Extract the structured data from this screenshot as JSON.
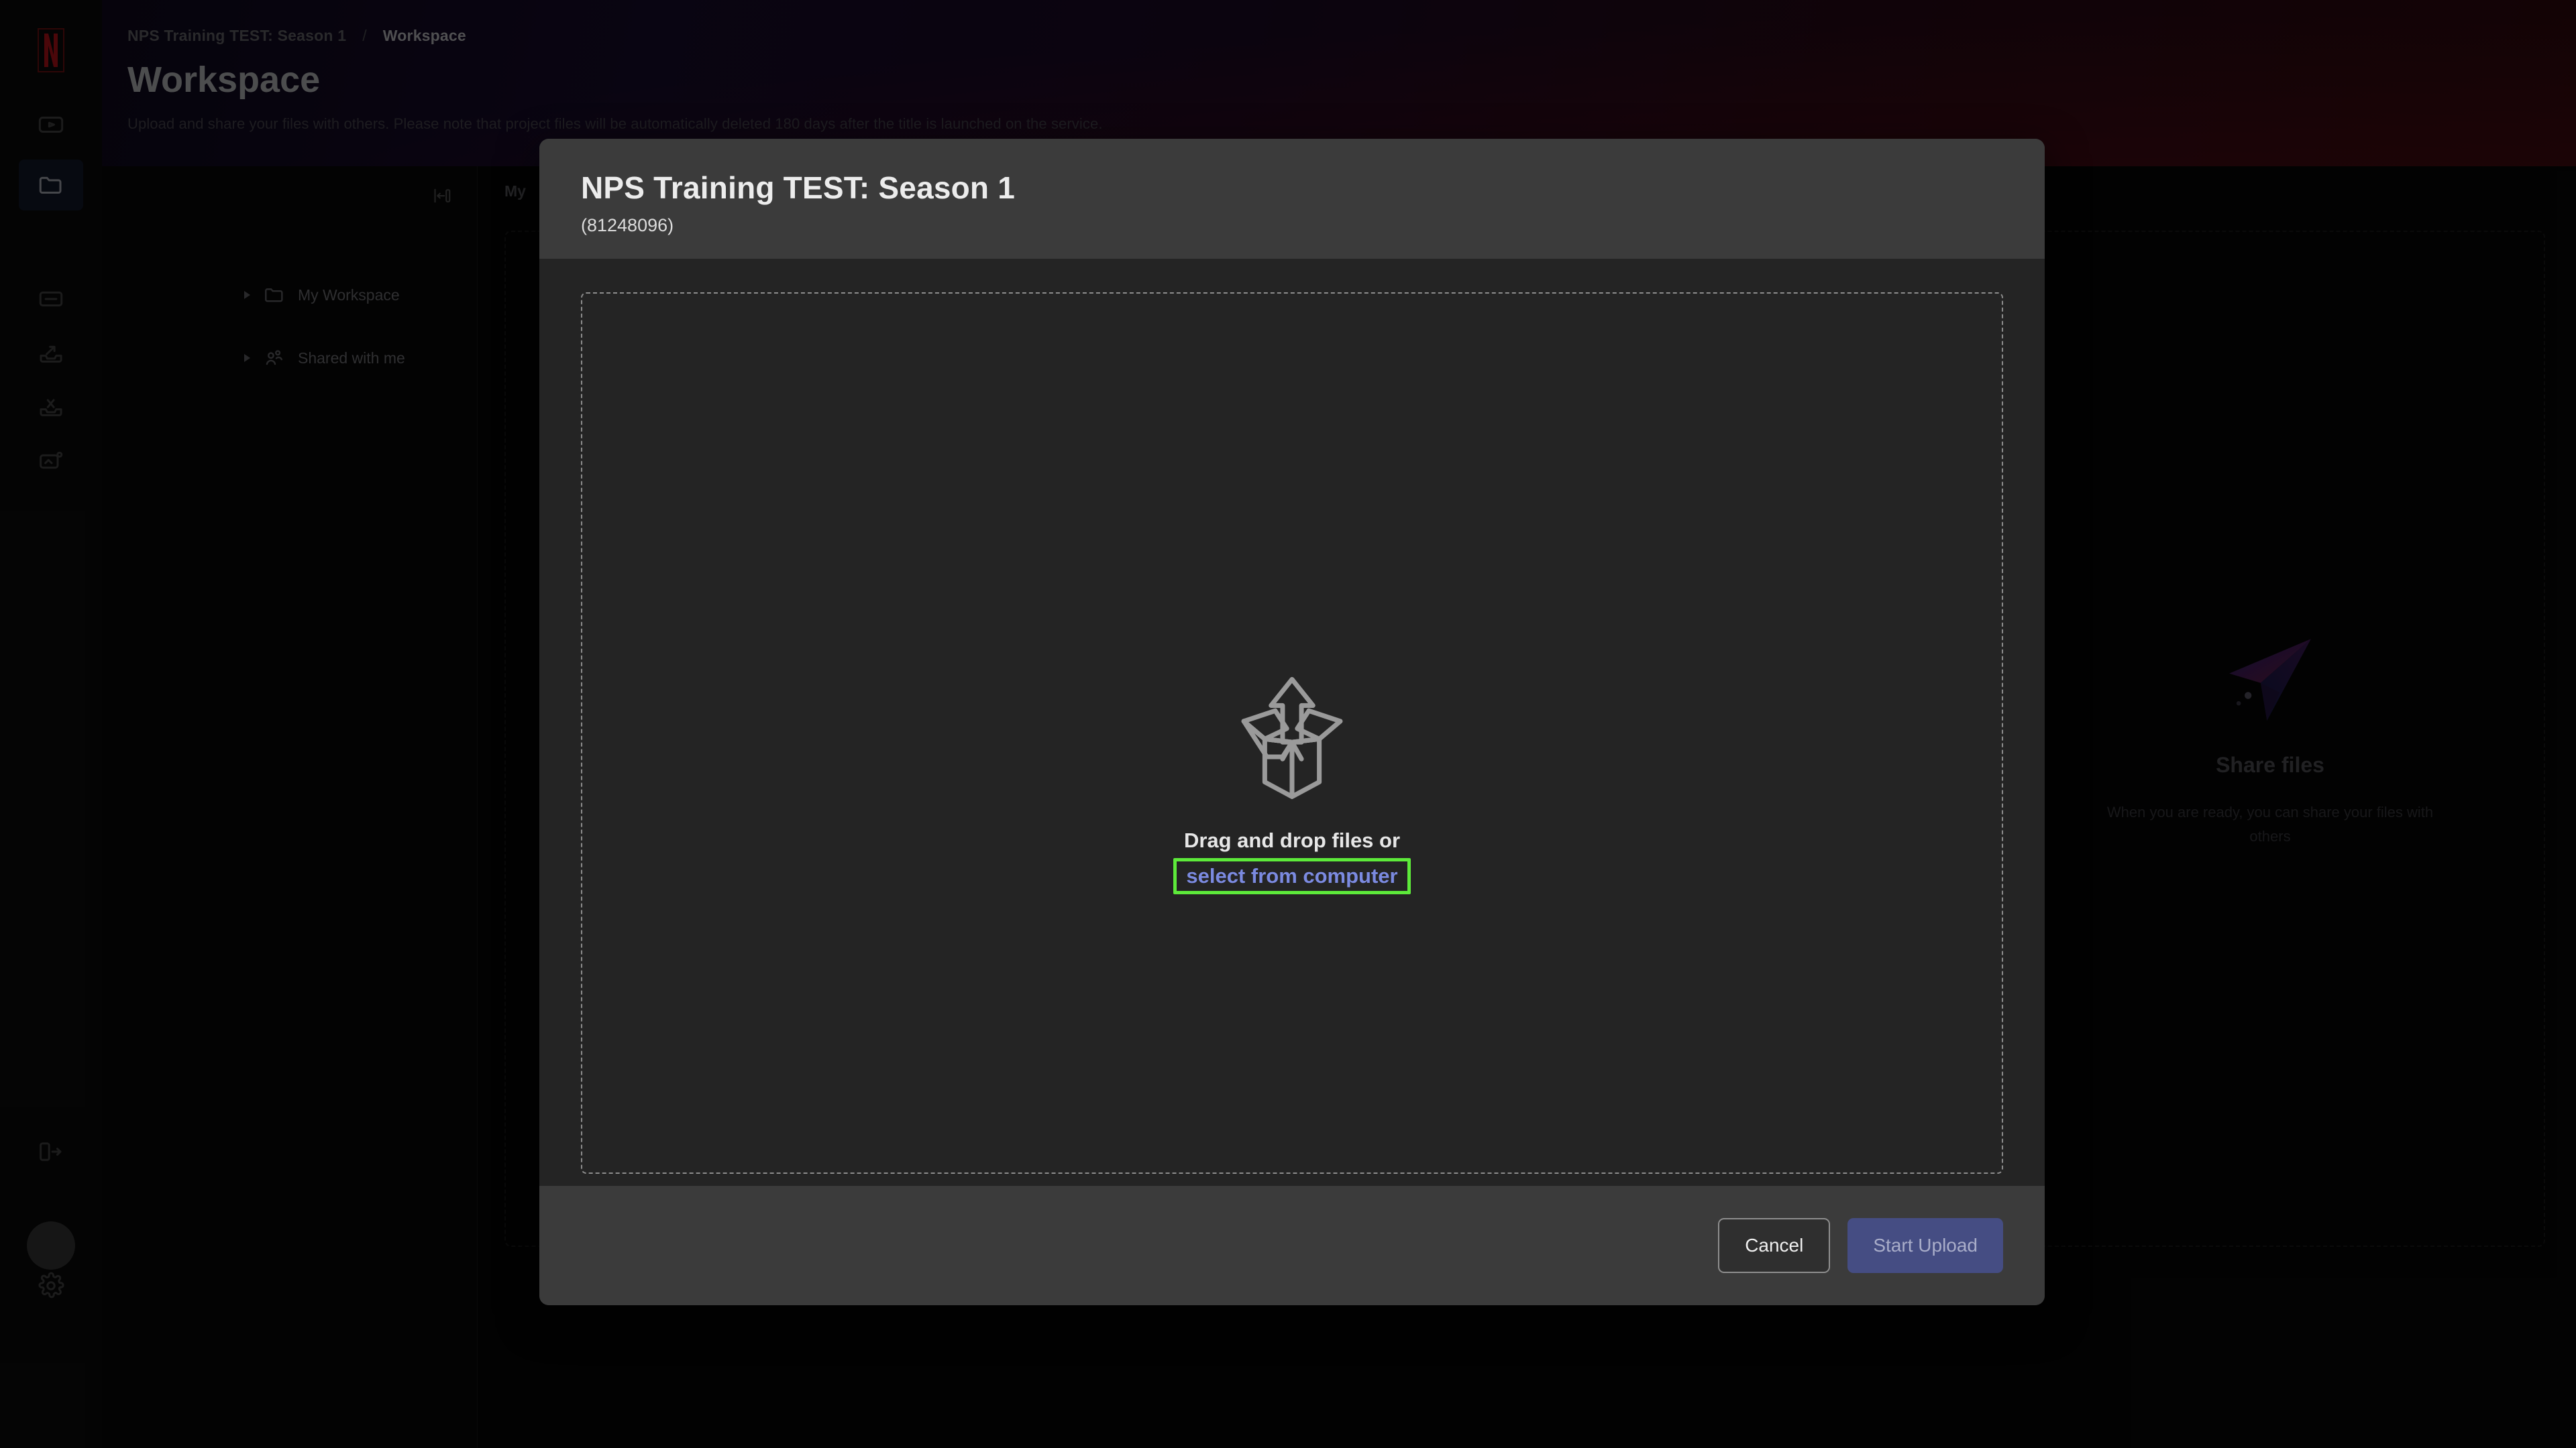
{
  "app": {
    "logo": "netflix-n-logo"
  },
  "rail": {
    "items": [
      {
        "name": "media-player-icon",
        "label": "Media"
      },
      {
        "name": "folder-icon",
        "label": "Workspace",
        "active": true
      },
      {
        "name": "card-icon",
        "label": "Assets"
      },
      {
        "name": "inbox-upload-icon",
        "label": "Uploads"
      },
      {
        "name": "inbox-cut-icon",
        "label": "Clips"
      },
      {
        "name": "inbox-add-icon",
        "label": "New"
      }
    ],
    "expand_label": "Expand sidebar",
    "settings_label": "Settings",
    "avatar_label": "Account"
  },
  "header": {
    "breadcrumb": {
      "parent": "NPS Training TEST: Season 1",
      "separator": "/",
      "current": "Workspace"
    },
    "title": "Workspace",
    "subtitle": "Upload and share your files with others. Please note that project files will be automatically deleted 180 days after the title is launched on the service."
  },
  "tree": {
    "collapse_icon": "collapse-panel-icon",
    "items": [
      {
        "label": "My Workspace",
        "icon": "folder-icon"
      },
      {
        "label": "Shared with me",
        "icon": "people-share-icon"
      }
    ]
  },
  "background": {
    "tab_label": "My",
    "share_panel": {
      "icon": "paper-plane-icon",
      "title": "Share files",
      "description": "When you are ready, you can share your files with others"
    }
  },
  "modal": {
    "title": "NPS Training TEST: Season 1",
    "subtitle": "(81248096)",
    "dropzone": {
      "icon": "open-box-upload-icon",
      "text": "Drag and drop files or",
      "link_label": "select from computer",
      "highlight_color": "#5dea3a",
      "link_color": "#7b8ae0"
    },
    "footer": {
      "cancel_label": "Cancel",
      "upload_label": "Start Upload",
      "upload_color": "#454d83"
    }
  }
}
